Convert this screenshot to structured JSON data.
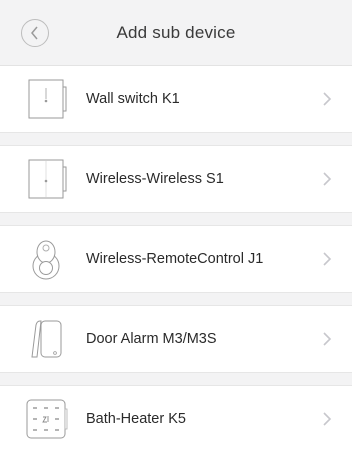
{
  "header": {
    "title": "Add sub device"
  },
  "devices": [
    {
      "label": "Wall switch K1",
      "icon": "wall-switch-icon"
    },
    {
      "label": "Wireless-Wireless S1",
      "icon": "wireless-switch-icon"
    },
    {
      "label": "Wireless-RemoteControl J1",
      "icon": "remote-control-icon"
    },
    {
      "label": "Door Alarm M3/M3S",
      "icon": "door-alarm-icon"
    },
    {
      "label": "Bath-Heater K5",
      "icon": "bath-heater-panel-icon"
    }
  ],
  "colors": {
    "header_bg": "#f3f3f4",
    "separator_bg": "#f3f3f4",
    "text": "#2a2a2a",
    "chevron": "#c7c7cc"
  }
}
